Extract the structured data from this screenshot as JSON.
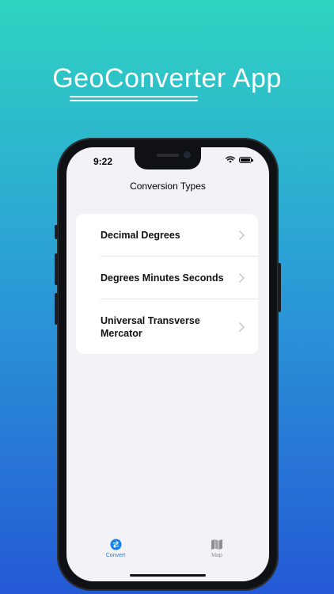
{
  "promo": {
    "headline": "GeoConverter App"
  },
  "status_bar": {
    "time": "9:22"
  },
  "nav": {
    "title": "Conversion Types"
  },
  "conversion_types": [
    {
      "label": "Decimal Degrees"
    },
    {
      "label": "Degrees Minutes Seconds"
    },
    {
      "label": "Universal Transverse Mercator"
    }
  ],
  "tabs": [
    {
      "label": "Convert",
      "icon": "arrows-swap-icon",
      "selected": true
    },
    {
      "label": "Map",
      "icon": "map-icon",
      "selected": false
    }
  ],
  "colors": {
    "accent": "#1a82e6",
    "tab_inactive": "#8e8e93",
    "background_top": "#2fd3c1",
    "background_bottom": "#2459d6"
  }
}
